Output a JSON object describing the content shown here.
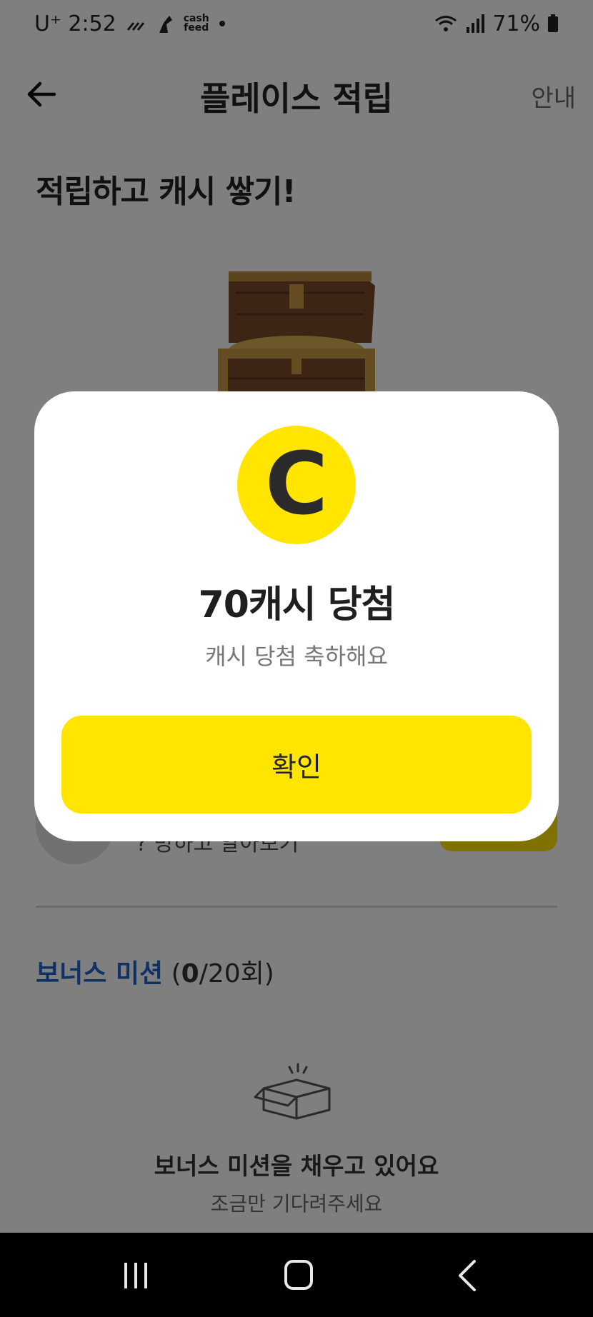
{
  "status_bar": {
    "carrier": "U⁺ 2:52",
    "app_badge": "cash\nfeed",
    "battery": "71%"
  },
  "header": {
    "title": "플레이스 적립",
    "help_label": "안내"
  },
  "hero": {
    "title": "적립하고 캐시 쌓기!"
  },
  "behind": {
    "row_label": "? 방하고 알아보기"
  },
  "bonus": {
    "title": "보너스 미션",
    "count_open": " (",
    "count_done": "0",
    "count_total": "/20회)",
    "empty_title": "보너스 미션을 채우고 있어요",
    "empty_sub": "조금만 기다려주세요"
  },
  "modal": {
    "coin_letter": "C",
    "title": "70캐시 당첨",
    "subtitle": "캐시 당첨 축하해요",
    "confirm_label": "확인"
  },
  "colors": {
    "accent_yellow": "#ffe500",
    "bonus_blue": "#1e63c9",
    "overlay": "rgba(0,0,0,0.5)"
  },
  "icons": {
    "back": "arrow-left-icon",
    "chest": "treasure-chest-icon",
    "box": "open-box-icon",
    "coin": "cash-coin-icon"
  }
}
